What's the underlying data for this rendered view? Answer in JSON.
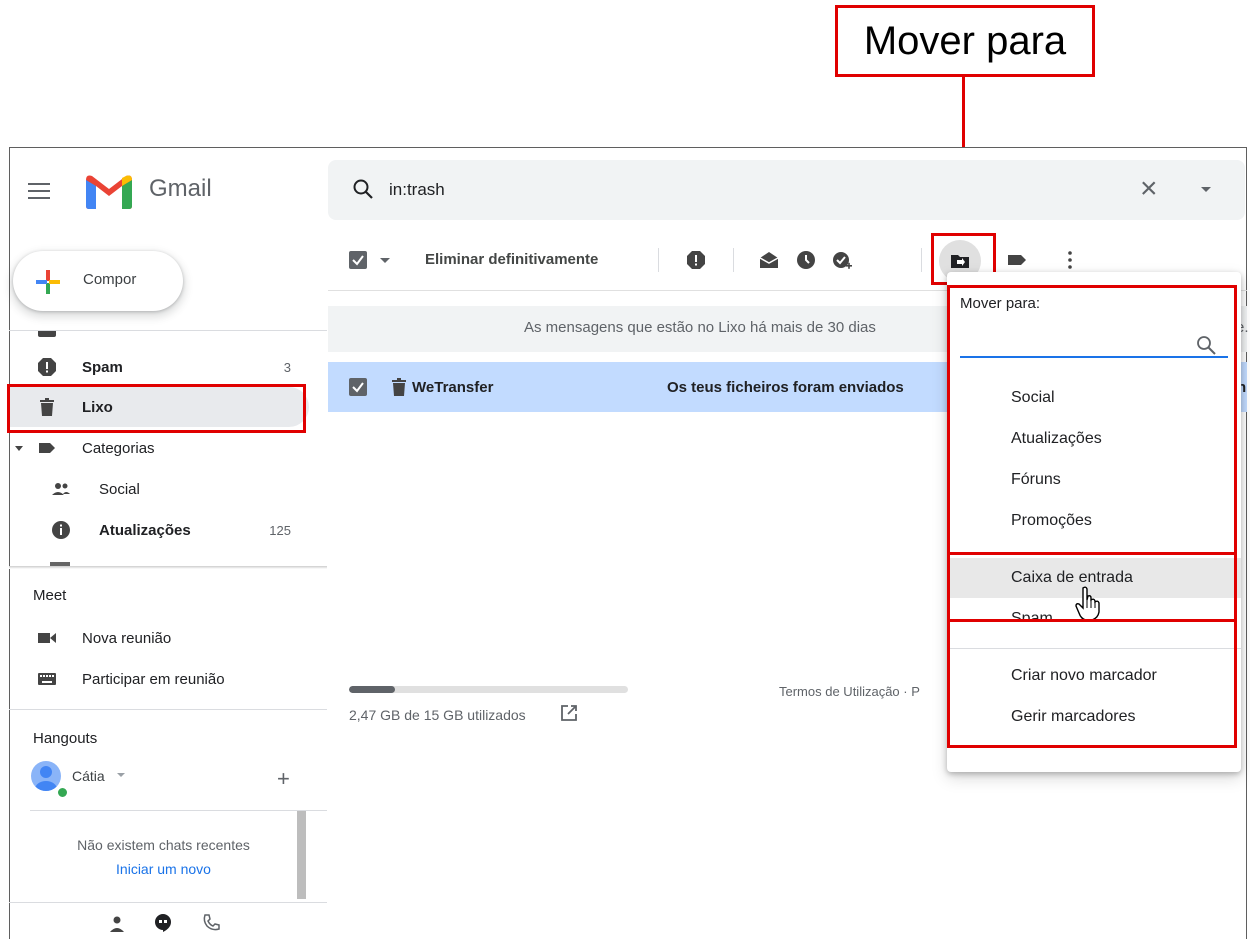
{
  "callout": {
    "label": "Mover para"
  },
  "header": {
    "app_name": "Gmail",
    "search_value": "in:trash"
  },
  "sidebar": {
    "compose_label": "Compor",
    "items": [
      {
        "label": "Spam",
        "count": "3"
      },
      {
        "label": "Lixo",
        "count": ""
      },
      {
        "label": "Categorias",
        "count": ""
      },
      {
        "label": "Social",
        "count": ""
      },
      {
        "label": "Atualizações",
        "count": "125"
      }
    ],
    "meet": {
      "title": "Meet",
      "new_meeting": "Nova reunião",
      "join_meeting": "Participar em reunião"
    },
    "hangouts": {
      "title": "Hangouts",
      "user": "Cátia",
      "no_chats": "Não existem chats recentes",
      "start_new": "Iniciar um novo"
    }
  },
  "toolbar": {
    "delete_forever": "Eliminar definitivamente"
  },
  "content": {
    "trash_notice": "As mensagens que estão no Lixo há mais de 30 dias",
    "trash_notice_tail": "e.",
    "email": {
      "sender": "WeTransfer",
      "subject": "Os teus ficheiros foram enviados",
      "subject_tail": "n"
    },
    "storage": {
      "text": "2,47 GB de 15 GB utilizados",
      "used_fraction": 0.165
    },
    "footer_terms": "Termos de Utilização · P"
  },
  "move_menu": {
    "title": "Mover para:",
    "items": [
      "Social",
      "Atualizações",
      "Fóruns",
      "Promoções",
      "Caixa de entrada",
      "Spam",
      "Criar novo marcador",
      "Gerir marcadores"
    ]
  },
  "colors": {
    "highlight_red": "#e00000",
    "selected_row": "#c2dbff",
    "link_blue": "#1a73e8"
  }
}
